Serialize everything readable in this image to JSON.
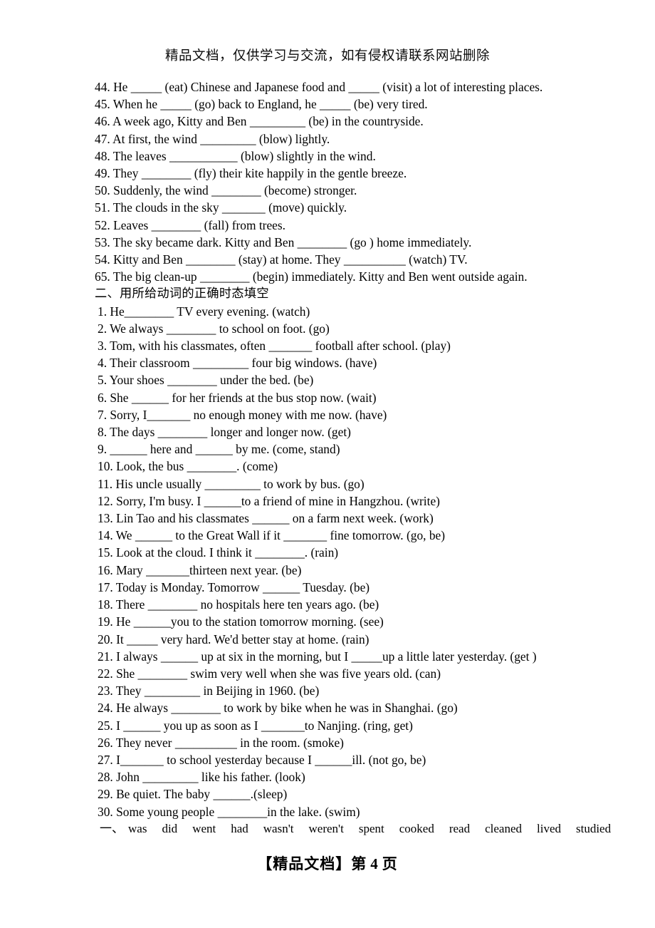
{
  "header": {
    "watermark": "精品文档，仅供学习与交流，如有侵权请联系网站删除"
  },
  "footer": {
    "prefix": "【精品文档】第",
    "page_number": "4",
    "suffix": "页"
  },
  "section_one": {
    "items": [
      "44. He _____ (eat) Chinese and Japanese food and _____ (visit) a lot of interesting places.",
      "45. When he _____ (go) back to England, he _____ (be) very tired.",
      "46. A week ago, Kitty and Ben _________ (be) in the countryside.",
      "47. At first, the wind _________ (blow) lightly.",
      "48. The leaves ___________ (blow) slightly in the wind.",
      "49. They ________ (fly) their kite happily in the gentle breeze.",
      "50. Suddenly, the wind ________ (become) stronger.",
      "51. The clouds in the sky _______ (move) quickly.",
      "52. Leaves ________ (fall) from trees.",
      "53. The sky became dark. Kitty and Ben ________ (go ) home immediately.",
      "54. Kitty and Ben ________ (stay) at home. They __________ (watch) TV.",
      "65. The big clean-up ________ (begin) immediately. Kitty and Ben went outside again."
    ]
  },
  "section_two": {
    "heading": "二、用所给动词的正确时态填空",
    "items": [
      "1. He________ TV every evening. (watch)",
      "2. We always ________ to school on foot. (go)",
      "3. Tom, with his classmates, often _______ football after school. (play)",
      "4. Their classroom _________ four big windows. (have)",
      "5. Your shoes ________ under the bed. (be)",
      "6. She ______ for her friends at the bus stop now. (wait)",
      "7. Sorry, I_______ no enough money with me now. (have)",
      "8. The days ________ longer and longer now. (get)",
      "9. ______ here and ______ by me. (come, stand)",
      "10. Look, the bus ________. (come)",
      "11. His uncle usually _________ to work by bus. (go)",
      "12. Sorry, I'm busy. I ______to a friend of mine in Hangzhou. (write)",
      "13. Lin Tao and his classmates ______ on a farm next week. (work)",
      "14. We ______ to the Great Wall if it _______ fine tomorrow. (go, be)",
      "15. Look at the cloud. I think it ________. (rain)",
      "16. Mary _______thirteen next year. (be)",
      "17. Today is Monday. Tomorrow ______ Tuesday. (be)",
      "18. There ________ no hospitals here ten years ago. (be)",
      "19. He ______you to the station tomorrow morning. (see)",
      "20. It _____ very hard. We'd better stay at home. (rain)",
      "21. I always ______ up at six in the morning, but I _____up a little later yesterday. (get )",
      "22. She ________ swim very well when she was five years old. (can)",
      "23. They _________ in Beijing in 1960. (be)",
      "24. He always ________ to work by bike when he was in Shanghai. (go)",
      "25. I ______ you up as soon as I _______to Nanjing. (ring, get)",
      "26. They never __________ in the room. (smoke)",
      "27. I_______ to school yesterday because I ______ill. (not go, be)",
      "28. John _________ like his father. (look)",
      "29. Be quiet. The baby ______.(sleep)",
      "30. Some young people ________in the lake. (swim)"
    ]
  },
  "answer_key": {
    "label": "一、",
    "words": [
      "was",
      "did",
      "went",
      "had",
      "wasn't",
      "weren't",
      "spent",
      "cooked",
      "read",
      "cleaned",
      "lived",
      "studied"
    ]
  }
}
